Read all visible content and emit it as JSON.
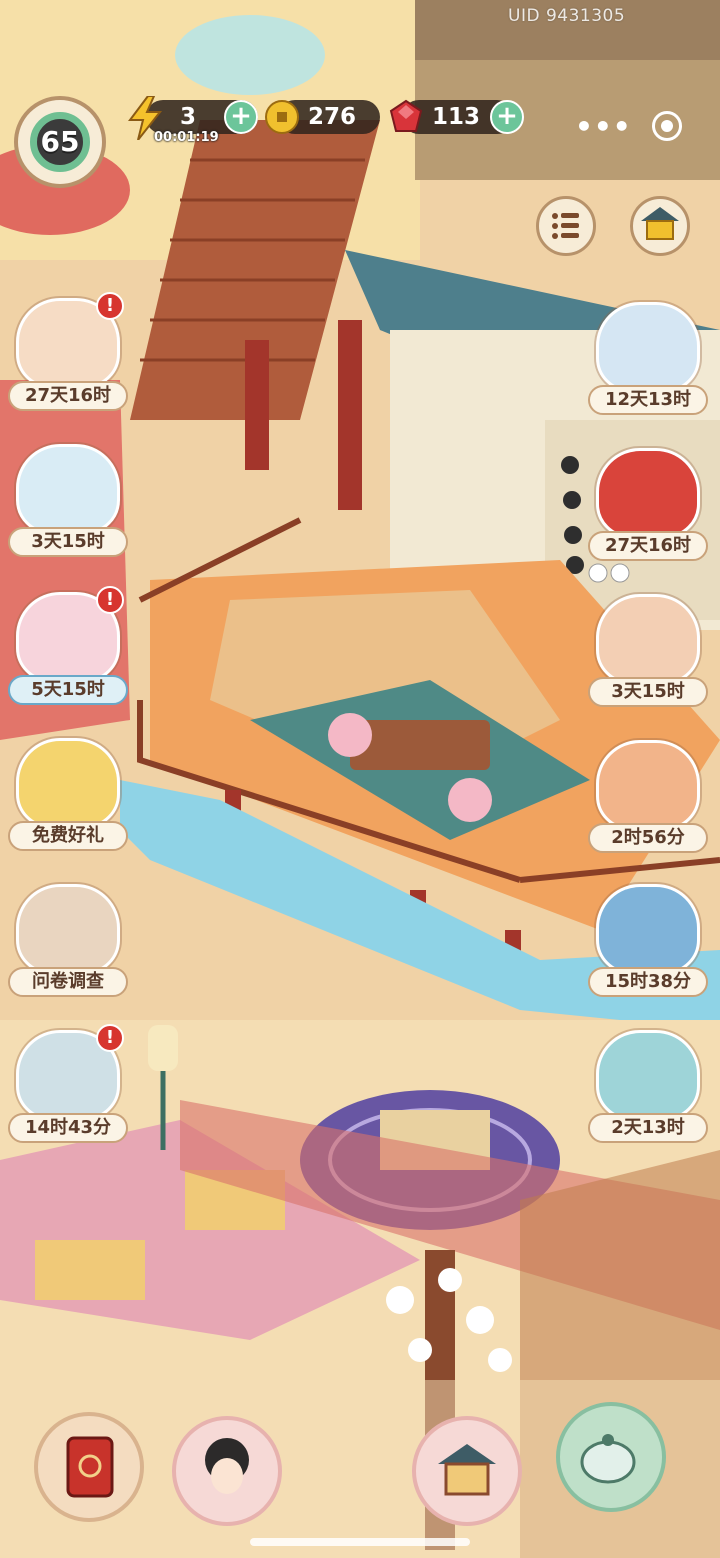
{
  "header": {
    "uid_text": "UID 9431305",
    "level": "65",
    "stamina": {
      "value": "3",
      "timer": "00:01:19",
      "icon": "lightning-icon"
    },
    "coins": {
      "value": "276",
      "icon": "coin-icon"
    },
    "gems": {
      "value": "113",
      "icon": "ruby-icon"
    },
    "plus_symbol": "+",
    "more_icon": "more-dots-icon",
    "more_glyph": "•••",
    "close_icon": "target-icon"
  },
  "top_buttons": {
    "list_icon": "list-menu-icon",
    "shop_icon": "gold-shrine-icon"
  },
  "left_events": [
    {
      "label": "27天16时",
      "alert": true,
      "icon": "calligraphy-scroll-icon",
      "bg": "#f6dcc5"
    },
    {
      "label": "3天15时",
      "alert": false,
      "icon": "fox-cat-icon",
      "bg": "#d9ecf5"
    },
    {
      "label": "5天15时",
      "alert": true,
      "icon": "pink-flower-charm-icon",
      "bg": "#f7d4dc",
      "blue": true
    },
    {
      "label": "免费好礼",
      "alert": false,
      "icon": "free-gift-icon",
      "bg": "#f4d46e"
    },
    {
      "label": "问卷调查",
      "alert": false,
      "icon": "survey-scroll-icon",
      "bg": "#e9d5c0"
    },
    {
      "label": "14时43分",
      "alert": true,
      "icon": "hero-portrait-icon",
      "bg": "#cfe0e6"
    }
  ],
  "right_events": [
    {
      "label": "12天13时",
      "alert": false,
      "icon": "cloud-cat-icon",
      "bg": "#d5e6f3"
    },
    {
      "label": "27天16时",
      "alert": false,
      "icon": "red-fan-gift-icon",
      "bg": "#d9443b"
    },
    {
      "label": "3天15时",
      "alert": false,
      "icon": "lucky-cat-icon",
      "bg": "#f3cfb4"
    },
    {
      "label": "2时56分",
      "alert": false,
      "icon": "treasure-pot-icon",
      "bg": "#f2b48a"
    },
    {
      "label": "15时38分",
      "alert": false,
      "icon": "one-plus-one-icon",
      "bg": "#7fb3d9"
    },
    {
      "label": "2天13时",
      "alert": false,
      "icon": "ice-cube-cat-icon",
      "bg": "#9ed4d8"
    }
  ],
  "bottom_bar": [
    {
      "name": "journal-button",
      "icon": "red-book-icon"
    },
    {
      "name": "character-button",
      "icon": "lady-portrait-icon"
    },
    {
      "name": "build-button",
      "icon": "pavilion-icon"
    },
    {
      "name": "teahouse-button",
      "icon": "teapot-icon"
    }
  ],
  "colors": {
    "accent_green": "#6cc59a",
    "label_text": "#5a3c2b",
    "alert_red": "#d7352f",
    "water": "#8fd3e6"
  }
}
